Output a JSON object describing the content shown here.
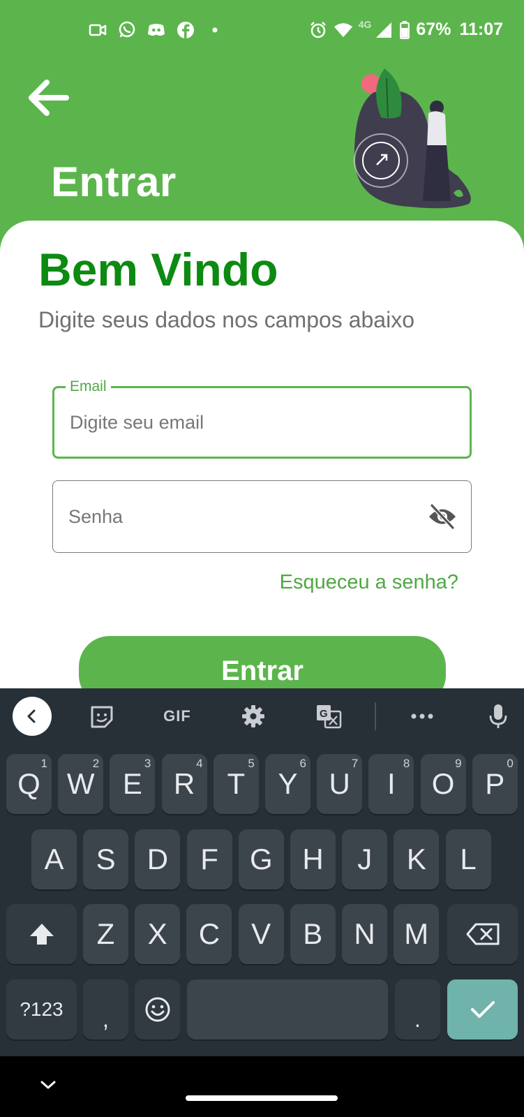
{
  "status_bar": {
    "battery": "67%",
    "time": "11:07",
    "network_type": "4G",
    "left_icons": [
      "video-icon",
      "whatsapp-icon",
      "discord-icon",
      "facebook-icon",
      "dot-icon"
    ],
    "right_icons": [
      "alarm-icon",
      "wifi-icon",
      "signal-icon",
      "battery-icon"
    ]
  },
  "header": {
    "back_icon": "arrow-left-icon",
    "title": "Entrar"
  },
  "card": {
    "welcome": "Bem Vindo",
    "subtitle": "Digite seus dados nos campos abaixo",
    "email": {
      "label": "Email",
      "placeholder": "Digite seu email",
      "value": ""
    },
    "password": {
      "placeholder": "Senha",
      "value": "",
      "toggle_icon": "eye-off-icon"
    },
    "forgot_link": "Esqueceu a senha?",
    "login_button": "Entrar"
  },
  "keyboard": {
    "toolbar": {
      "gif_label": "GIF",
      "icons": [
        "chevron-left-icon",
        "sticker-icon",
        "gif-icon",
        "gear-icon",
        "translate-icon",
        "more-icon",
        "mic-icon"
      ]
    },
    "row1": [
      {
        "k": "Q",
        "h": "1"
      },
      {
        "k": "W",
        "h": "2"
      },
      {
        "k": "E",
        "h": "3"
      },
      {
        "k": "R",
        "h": "4"
      },
      {
        "k": "T",
        "h": "5"
      },
      {
        "k": "Y",
        "h": "6"
      },
      {
        "k": "U",
        "h": "7"
      },
      {
        "k": "I",
        "h": "8"
      },
      {
        "k": "O",
        "h": "9"
      },
      {
        "k": "P",
        "h": "0"
      }
    ],
    "row2": [
      "A",
      "S",
      "D",
      "F",
      "G",
      "H",
      "J",
      "K",
      "L"
    ],
    "row3": [
      "Z",
      "X",
      "C",
      "V",
      "B",
      "N",
      "M"
    ],
    "symbols_key": "?123",
    "comma_key": ",",
    "period_key": "."
  },
  "colors": {
    "primary": "#5cb54c",
    "title_green": "#0c8a12",
    "keyboard_bg": "#283037",
    "key_bg": "#3c444c",
    "enter_key": "#6fb3ab"
  }
}
